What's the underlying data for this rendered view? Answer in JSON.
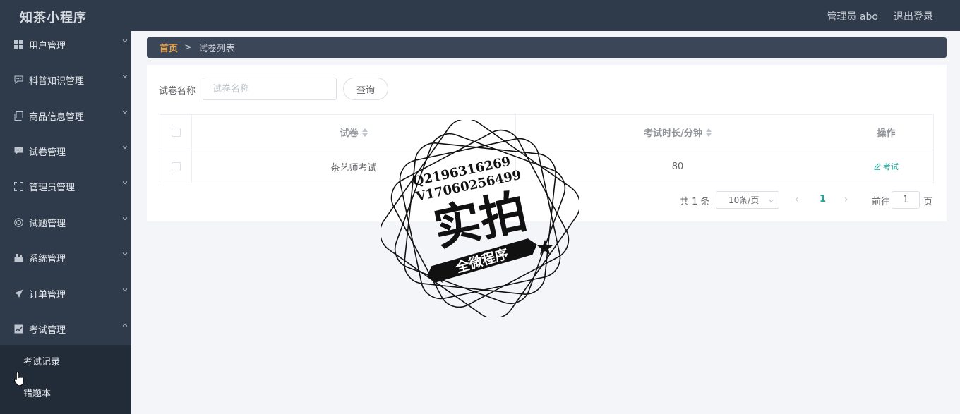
{
  "app": {
    "title": "知茶小程序"
  },
  "header": {
    "admin_label": "管理员 abo",
    "logout_label": "退出登录"
  },
  "sidebar": {
    "items": [
      {
        "label": "用户管理",
        "icon": "grid-icon"
      },
      {
        "label": "科普知识管理",
        "icon": "comment-icon"
      },
      {
        "label": "商品信息管理",
        "icon": "copy-icon"
      },
      {
        "label": "试卷管理",
        "icon": "chat-icon"
      },
      {
        "label": "管理员管理",
        "icon": "fullscreen-icon"
      },
      {
        "label": "试题管理",
        "icon": "target-icon"
      },
      {
        "label": "系统管理",
        "icon": "house-icon"
      },
      {
        "label": "订单管理",
        "icon": "paper-plane-icon"
      },
      {
        "label": "考试管理",
        "icon": "chart-icon"
      }
    ],
    "sub_items": [
      {
        "label": "考试记录"
      },
      {
        "label": "错题本"
      }
    ]
  },
  "breadcrumb": {
    "home": "首页",
    "separator": ">",
    "current": "试卷列表"
  },
  "search": {
    "label": "试卷名称",
    "placeholder": "试卷名称",
    "button": "查询"
  },
  "table": {
    "columns": [
      "试卷",
      "考试时长/分钟",
      "操作"
    ],
    "rows": [
      {
        "name": "茶艺师考试",
        "duration": "80",
        "action": "考试"
      }
    ]
  },
  "pagination": {
    "total": "共 1 条",
    "page_size": "10条/页",
    "current_page": "1",
    "goto_label": "前往",
    "goto_value": "1",
    "page_unit": "页"
  },
  "watermark": {
    "line1": "Q2196316269",
    "line2": "V17060256499",
    "big_text": "实拍",
    "banner_text": "全微程序"
  },
  "colors": {
    "sidebar_bg": "#2f3b4b",
    "accent_orange": "#e8a64a",
    "accent_teal": "#18a99a"
  }
}
